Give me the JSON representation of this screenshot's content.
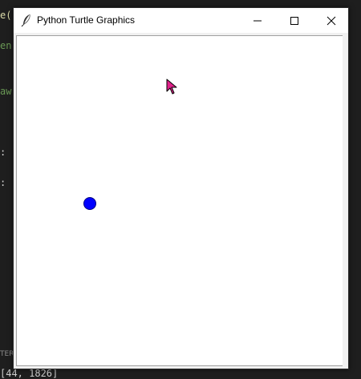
{
  "background": {
    "code_fragments": [
      "e(",
      "en",
      "aw",
      ":",
      ":"
    ],
    "status_fragment": "TER",
    "coords_fragment": "[44, 1826]"
  },
  "window": {
    "title": "Python Turtle Graphics",
    "controls": {
      "minimize": "minimize-icon",
      "maximize": "maximize-icon",
      "close": "close-icon"
    }
  },
  "canvas": {
    "background_color": "#ffffff",
    "turtle_dot_color": "#0000ff",
    "cursor_color": "#e0218a"
  }
}
